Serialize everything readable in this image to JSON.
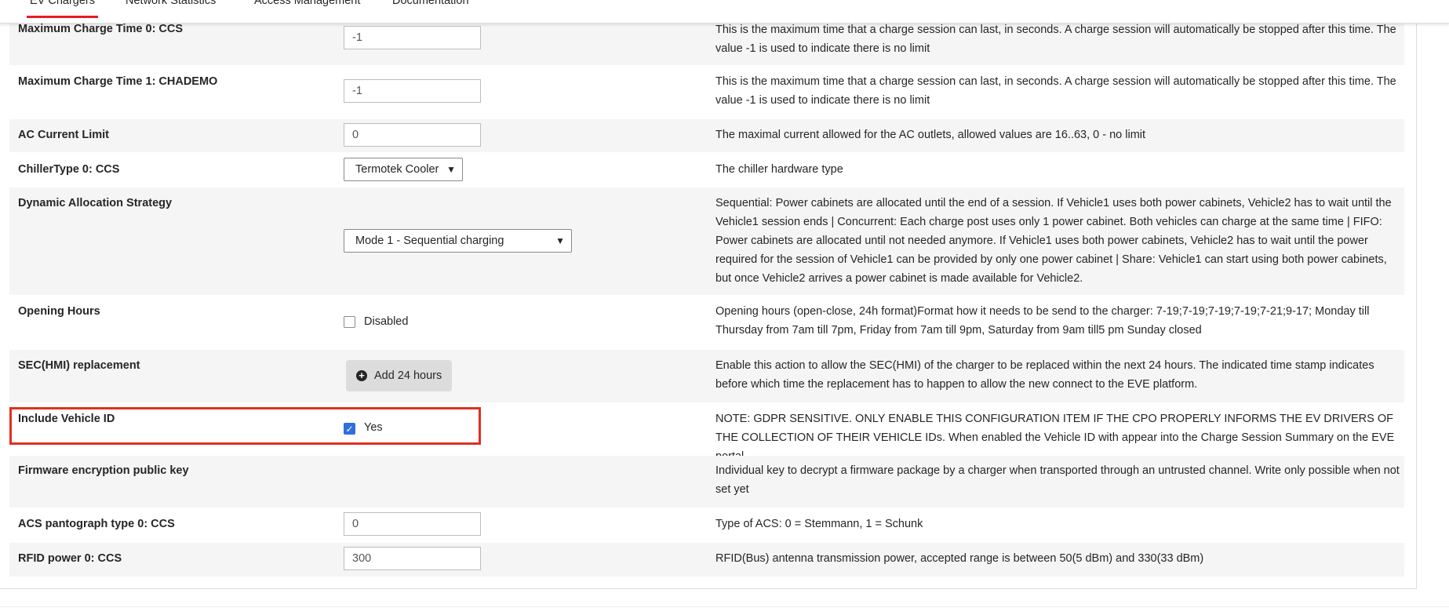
{
  "nav": {
    "tabs": [
      {
        "label": "EV Chargers",
        "active": true
      },
      {
        "label": "Network Statistics",
        "active": false
      },
      {
        "label": "Access Management",
        "active": false
      },
      {
        "label": "Documentation",
        "active": false
      }
    ]
  },
  "settings": [
    {
      "label": "Maximum Charge Time 0: CCS",
      "control": "input",
      "value": "-1",
      "description": "This is the maximum time that a charge session can last, in seconds. A charge session will automatically be stopped after this time. The value -1 is used to indicate there is no limit"
    },
    {
      "label": "Maximum Charge Time 1: CHADEMO",
      "control": "input",
      "value": "-1",
      "description": "This is the maximum time that a charge session can last, in seconds. A charge session will automatically be stopped after this time. The value -1 is used to indicate there is no limit"
    },
    {
      "label": "AC Current Limit",
      "control": "input",
      "value": "0",
      "description": "The maximal current allowed for the AC outlets, allowed values are 16..63, 0 - no limit"
    },
    {
      "label": "ChillerType 0: CCS",
      "control": "select",
      "value": "Termotek Cooler",
      "description": "The chiller hardware type"
    },
    {
      "label": "Dynamic Allocation Strategy",
      "control": "select",
      "value": "Mode 1 - Sequential charging",
      "description": "Sequential: Power cabinets are allocated until the end of a session. If Vehicle1 uses both power cabinets, Vehicle2 has to wait until the Vehicle1 session ends | Concurrent: Each charge post uses only 1 power cabinet. Both vehicles can charge at the same time | FIFO: Power cabinets are allocated until not needed anymore. If Vehicle1 uses both power cabinets, Vehicle2 has to wait until the power required for the session of Vehicle1 can be provided by only one power cabinet | Share: Vehicle1 can start using both power cabinets, but once Vehicle2 arrives a power cabinet is made available for Vehicle2."
    },
    {
      "label": "Opening Hours",
      "control": "checkbox",
      "checked": false,
      "value": "Disabled",
      "description": "Opening hours (open-close, 24h format)Format how it needs to be send to the charger: 7-19;7-19;7-19;7-19;7-21;9-17; Monday till Thursday from 7am till 7pm, Friday from 7am till 9pm, Saturday from 9am till5 pm Sunday closed"
    },
    {
      "label": "SEC(HMI) replacement",
      "control": "button",
      "value": "Add 24 hours",
      "description": "Enable this action to allow the SEC(HMI) of the charger to be replaced within the next 24 hours. The indicated time stamp indicates before which time the replacement has to happen to allow the new connect to the EVE platform."
    },
    {
      "label": "Include Vehicle ID",
      "control": "checkbox",
      "checked": true,
      "value": "Yes",
      "description": "NOTE: GDPR SENSITIVE. ONLY ENABLE THIS CONFIGURATION ITEM IF THE CPO PROPERLY INFORMS THE EV DRIVERS OF THE COLLECTION OF THEIR VEHICLE IDs. When enabled the Vehicle ID with appear into the Charge Session Summary on the EVE portal."
    },
    {
      "label": "Firmware encryption public key",
      "control": "none",
      "description": "Individual key to decrypt a firmware package by a charger when transported through an untrusted channel. Write only possible when not set yet"
    },
    {
      "label": "ACS pantograph type 0: CCS",
      "control": "input",
      "value": "0",
      "description": "Type of ACS: 0 = Stemmann, 1 = Schunk"
    },
    {
      "label": "RFID power 0: CCS",
      "control": "input",
      "value": "300",
      "description": "RFID(Bus) antenna transmission power, accepted range is between 50(5 dBm) and 330(33 dBm)"
    }
  ],
  "icons": {
    "checkmark": "checkmark-icon",
    "add": "plus-circle-icon",
    "chevron": "chevron-down-icon"
  },
  "colors": {
    "accent": "#e31e25",
    "highlight_border": "#e0301e",
    "checkbox_checked": "#2f6fde",
    "row_alt": "#f5f5f5"
  }
}
